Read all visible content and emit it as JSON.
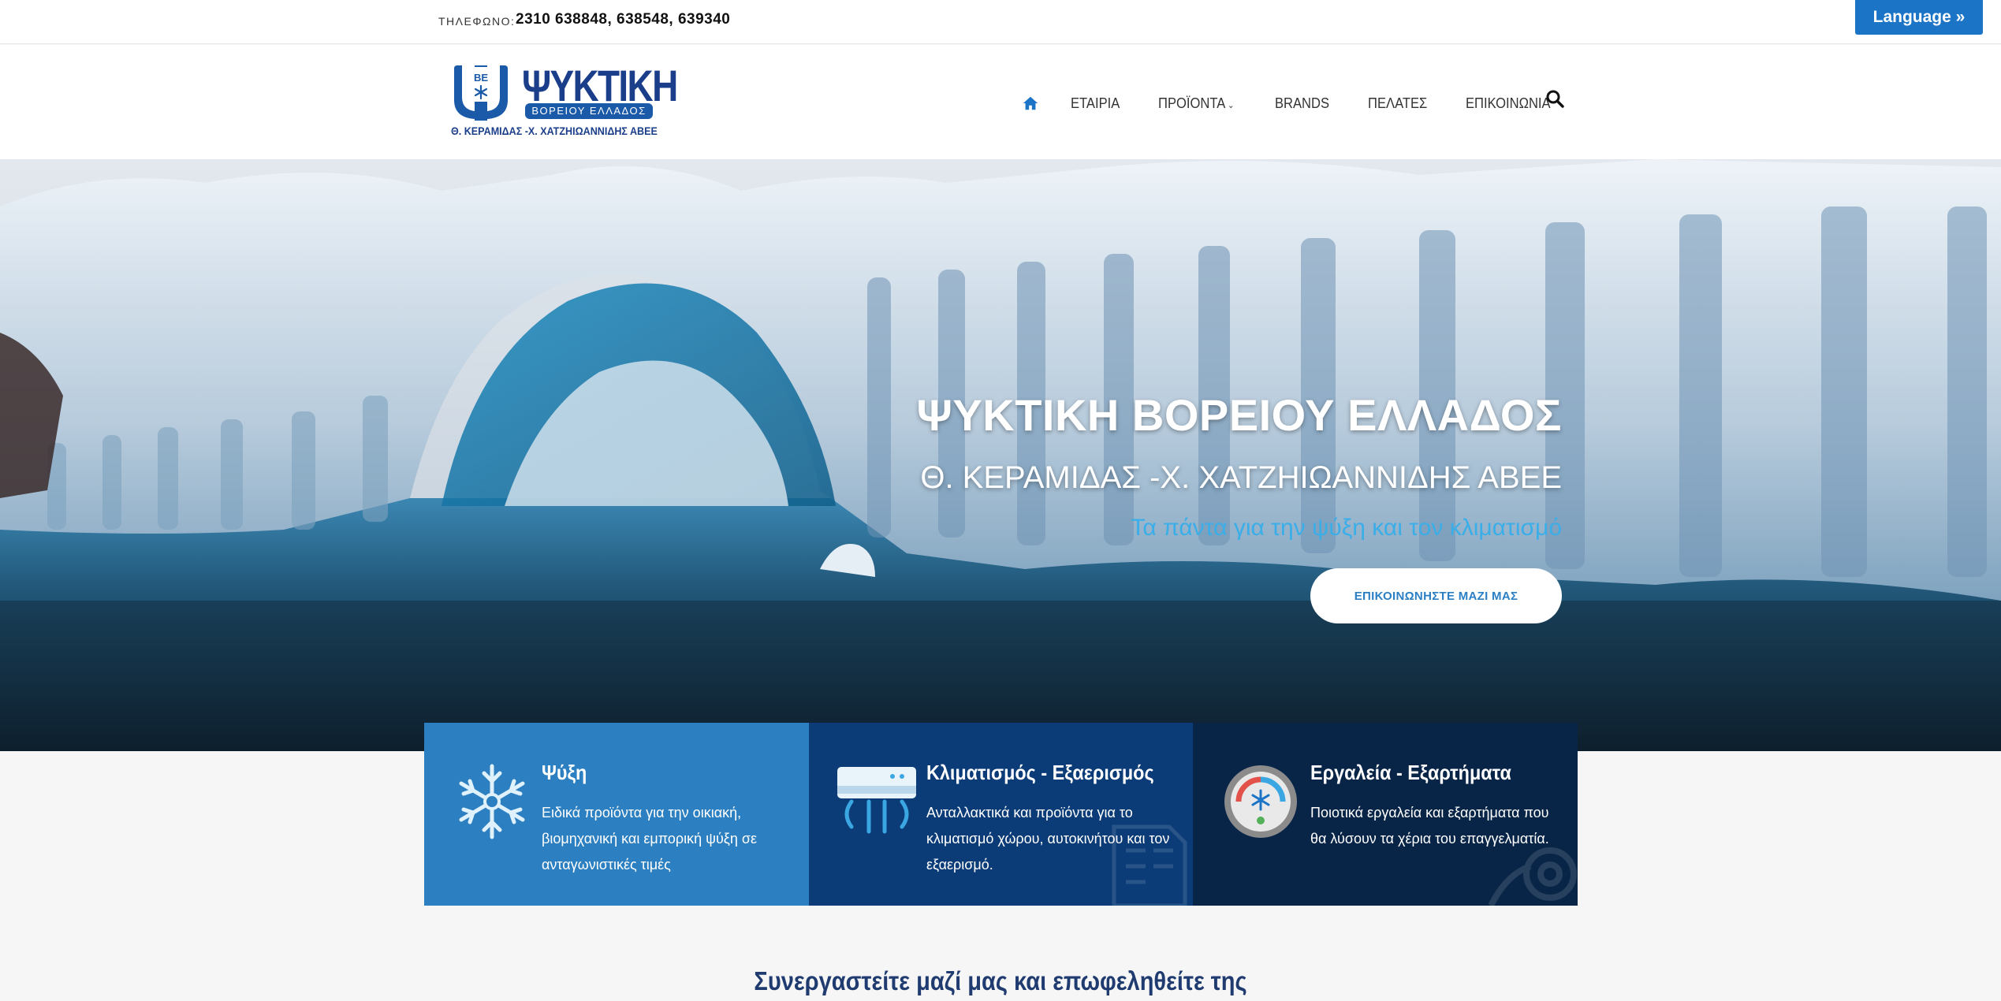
{
  "topbar": {
    "phone_label": "ΤΗΛΕΦΩΝΟ:",
    "phone_value": "2310 638848, 638548, 639340",
    "language_button": "Language »"
  },
  "logo": {
    "brand": "ΨΥΚΤΙΚΗ",
    "sub": "ΒΟΡΕΙΟΥ ΕΛΛΑΔΟΣ",
    "sub2": "Θ. ΚΕΡΑΜΙΔΑΣ -Χ. ΧΑΤΖΗΙΩΑΝΝΙΔΗΣ ΑΒΕΕ",
    "mark_text": "ΒΕ"
  },
  "nav": {
    "home_icon": "home-icon",
    "items": [
      {
        "label": "ΕΤΑΙΡΙΑ"
      },
      {
        "label": "ΠΡΟΪΟΝΤΑ",
        "caret": "⌄"
      },
      {
        "label": "BRANDS"
      },
      {
        "label": "ΠΕΛΑΤΕΣ"
      },
      {
        "label": "ΕΠΙΚΟΙΝΩΝΙΑ"
      }
    ],
    "search_icon": "search-icon"
  },
  "hero": {
    "title": "ΨΥΚΤΙΚΗ ΒΟΡΕΙΟΥ ΕΛΛΑΔΟΣ",
    "subtitle": "Θ. ΚΕΡΑΜΙΔΑΣ -Χ. ΧΑΤΖΗΙΩΑΝΝΙΔΗΣ ΑΒΕΕ",
    "tagline": "Τα πάντα για την ψύξη και τον κλιματισμό",
    "cta": "ΕΠΙΚΟΙΝΩΝΗΣΤΕ ΜΑΖΙ ΜΑΣ"
  },
  "features": [
    {
      "title": "Ψύξη",
      "desc": "Ειδικά προϊόντα για την οικιακή, βιομηχανική και εμπορική ψύξη σε ανταγωνιστικές τιμές",
      "icon": "snowflake-icon"
    },
    {
      "title": "Κλιματισμός - Εξαερισμός",
      "desc": "Ανταλλακτικά και προϊόντα για το κλιματισμό χώρου, αυτοκινήτου και τον εξαερισμό.",
      "icon": "air-conditioner-icon"
    },
    {
      "title": "Εργαλεία - Εξαρτήματα",
      "desc": "Ποιοτικά εργαλεία και εξαρτήματα που θα λύσουν τα χέρια του επαγγελματία.",
      "icon": "thermostat-icon"
    }
  ],
  "bottom_heading": "Συνεργαστείτε μαζί μας και επωφεληθείτε της",
  "colors": {
    "accent_blue": "#1c74c7",
    "tagline_blue": "#39aee9",
    "feature1": "#2c7fc0",
    "feature2": "#0b3c78",
    "feature3": "#082548",
    "heading_navy": "#1f3b70"
  }
}
